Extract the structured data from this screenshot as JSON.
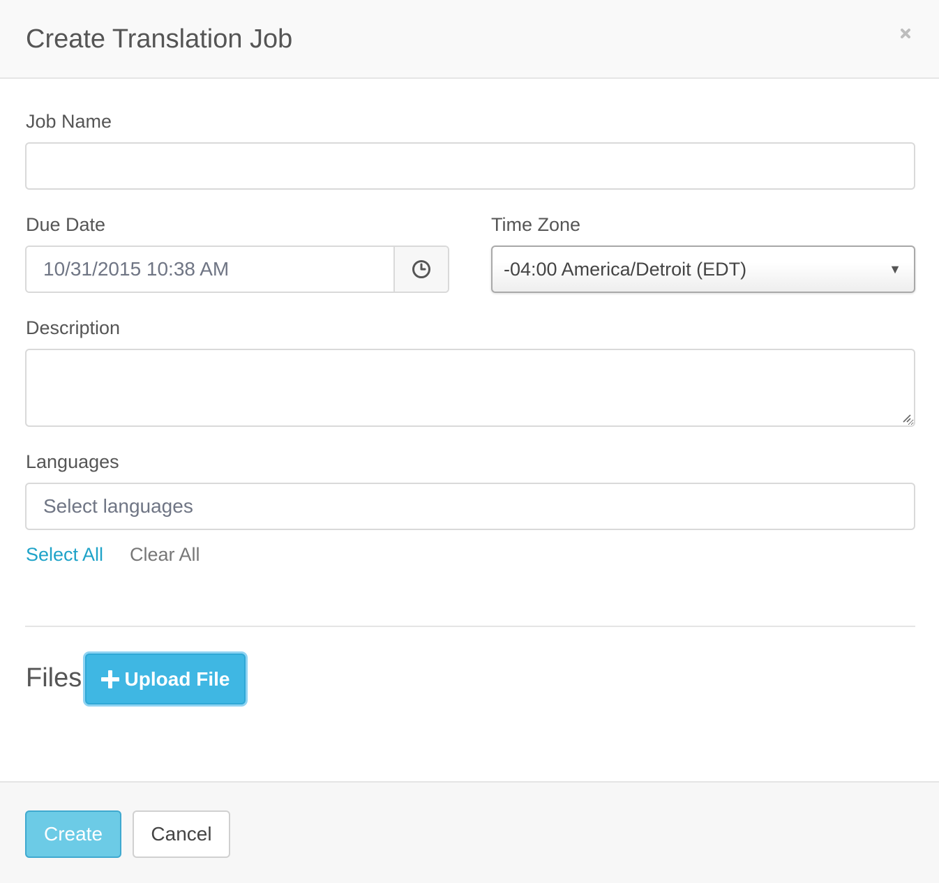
{
  "dialog": {
    "title": "Create Translation Job",
    "close_icon": "close-icon"
  },
  "form": {
    "job_name": {
      "label": "Job Name",
      "value": "",
      "placeholder": ""
    },
    "due_date": {
      "label": "Due Date",
      "value": "10/31/2015 10:38 AM",
      "icon": "clock-icon"
    },
    "time_zone": {
      "label": "Time Zone",
      "selected": "-04:00 America/Detroit (EDT)",
      "icon": "caret-down-icon"
    },
    "description": {
      "label": "Description",
      "value": ""
    },
    "languages": {
      "label": "Languages",
      "placeholder": "Select languages",
      "select_all": "Select All",
      "clear_all": "Clear All"
    }
  },
  "files": {
    "heading": "Files",
    "upload_label": "Upload File",
    "upload_icon": "plus-icon"
  },
  "footer": {
    "create_label": "Create",
    "cancel_label": "Cancel"
  },
  "colors": {
    "accent": "#1fa3c8",
    "upload_button": "#3fb7e3",
    "create_button": "#6ccbe6"
  }
}
